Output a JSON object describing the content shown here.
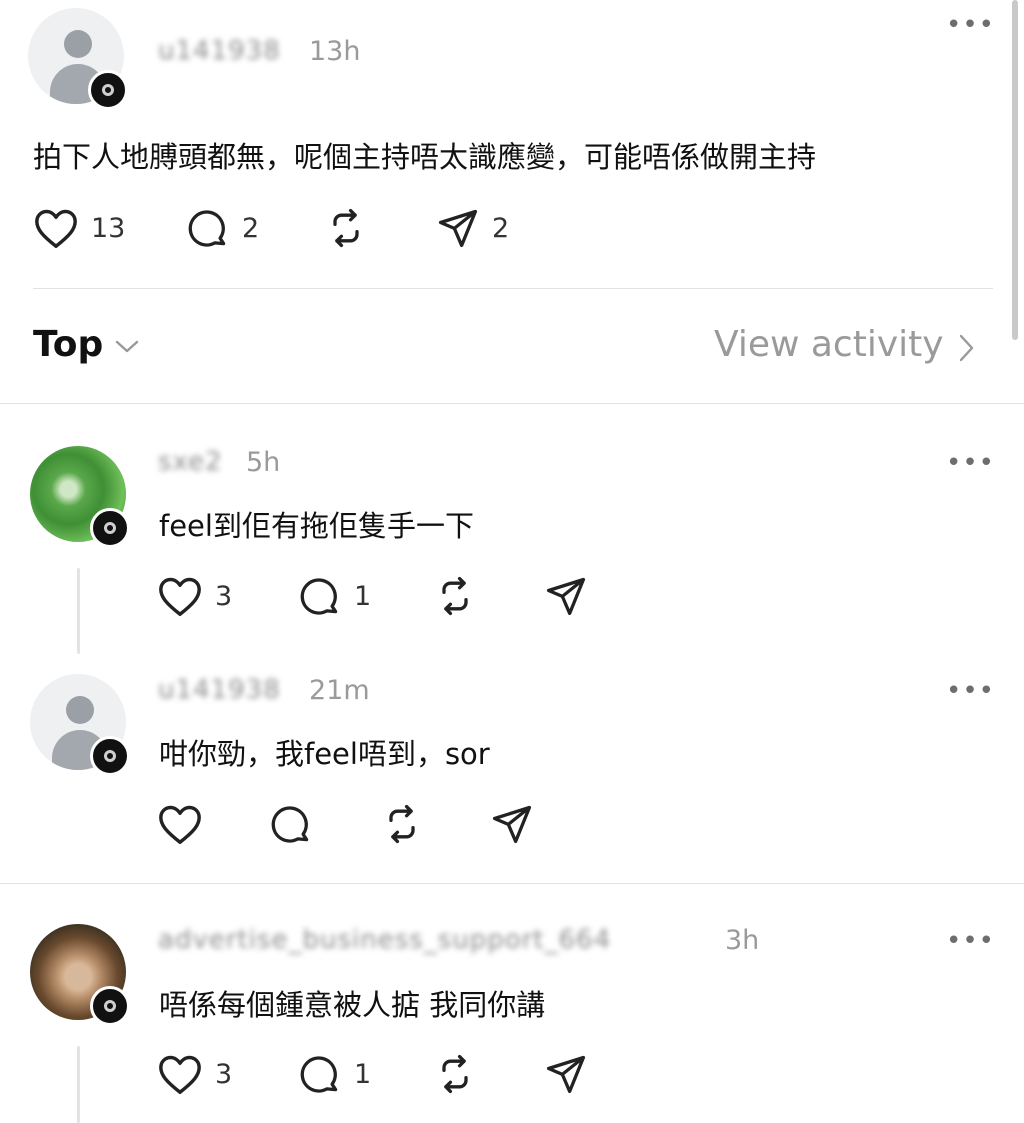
{
  "post": {
    "username": "u141938",
    "time": "13h",
    "text": "拍下人地膊頭都無，呢個主持唔太識應變，可能唔係做開主持",
    "likes": "13",
    "comments": "2",
    "shares": "2"
  },
  "sort": {
    "label": "Top",
    "view_activity": "View activity"
  },
  "replies": [
    {
      "username": "sxe2",
      "time": "5h",
      "text": "feel到佢有拖佢隻手一下",
      "likes": "3",
      "comments": "1"
    },
    {
      "username": "u141938",
      "time": "21m",
      "text": "咁你勁，我feel唔到，sor",
      "likes": "",
      "comments": ""
    },
    {
      "username": "advertise_business_support_664",
      "time": "3h",
      "text": "唔係每個鍾意被人掂 我同你講",
      "likes": "3",
      "comments": "1"
    }
  ],
  "icons": {
    "like": "heart-icon",
    "comment": "comment-bubble-icon",
    "repost": "repost-icon",
    "share": "send-icon",
    "more": "more-icon"
  }
}
